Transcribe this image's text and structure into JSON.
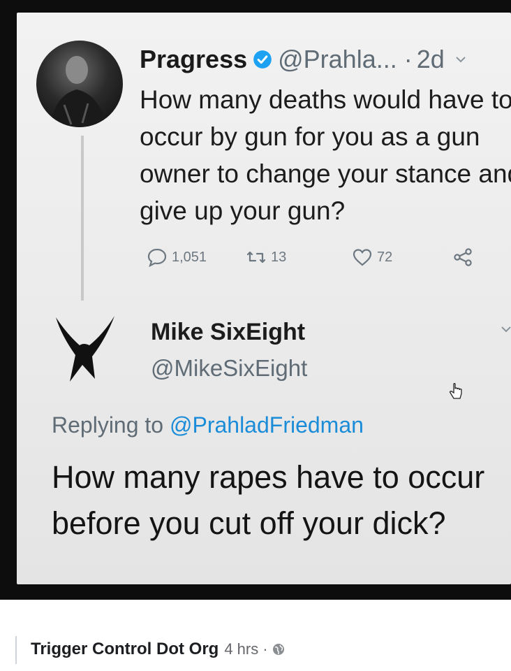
{
  "tweet": {
    "display_name": "Pragress",
    "handle": "@Prahla...",
    "separator": "·",
    "time": "2d",
    "text": "How many deaths would have to occur by gun for you as a gun owner to change your stance and give up your gun?",
    "replies": "1,051",
    "retweets": "13",
    "likes": "72"
  },
  "reply": {
    "display_name": "Mike SixEight",
    "handle": "@MikeSixEight",
    "replying_prefix": "Replying to ",
    "replying_to": "@PrahladFriedman",
    "text": "How many rapes have to occur before you cut off your dick?"
  },
  "post": {
    "page_name": "Trigger Control Dot Org",
    "time": "4 hrs",
    "separator": "·"
  },
  "colors": {
    "verified": "#1da1f2",
    "link": "#1a8cd8",
    "secondary_text": "#5f6b75"
  },
  "icons": {
    "verified": "verified-badge-icon",
    "reply": "speech-bubble-icon",
    "retweet": "retweet-icon",
    "like": "heart-icon",
    "share": "share-icon",
    "caret": "chevron-down-icon",
    "cursor": "hand-cursor-icon",
    "audience": "globe-icon"
  }
}
